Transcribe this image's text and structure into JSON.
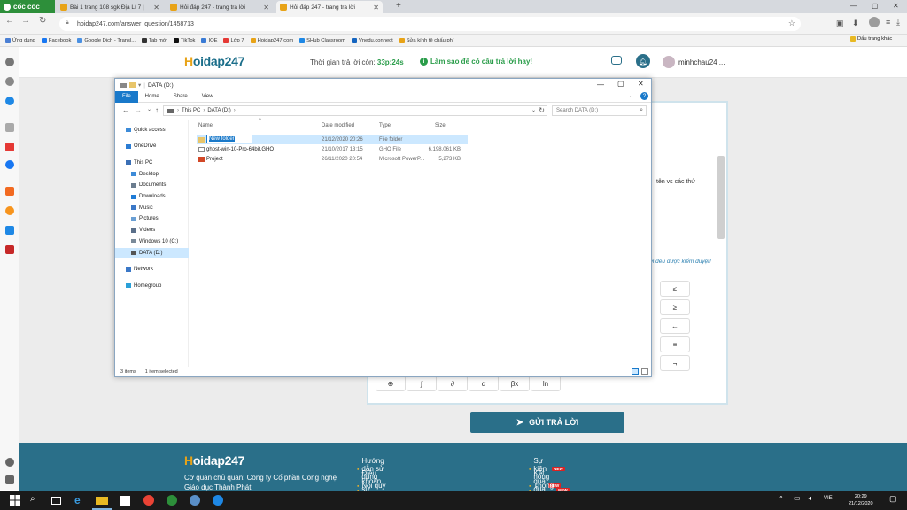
{
  "browser": {
    "brand": "cốc cốc",
    "tabs": [
      {
        "label": "Bài 1 trang 108 sgk Địa Lí 7 |",
        "color": "#e8a317",
        "active": false
      },
      {
        "label": "Hỏi đáp 247 - trang tra lời",
        "color": "#e8a317",
        "active": false
      },
      {
        "label": "Hỏi đáp 247 - trang tra lời",
        "color": "#e8a317",
        "active": true
      }
    ],
    "url": "hoidap247.com/answer_question/1458713",
    "bookmarks": [
      "Ứng dụng",
      "Facebook",
      "Google Dịch - Transl...",
      "Tab mới",
      "TikTok",
      "IOE",
      "Lớp 7",
      "Hoidap247.com",
      "SHub Classroom",
      "Vnedu.connect",
      "Sửa kính tê chấu phí"
    ],
    "bookmark_colors": [
      "#4a7fd4",
      "#1877f2",
      "#4a90e2",
      "#333",
      "#111",
      "#3a7bd5",
      "#e53935",
      "#e8a317",
      "#1e88e5",
      "#1565c0",
      "#e8a317"
    ],
    "other_bookmarks": "Dấu trang khác"
  },
  "site": {
    "logo_h": "H",
    "logo_rest": "oidap247",
    "timer_label": "Thời gian trả lời còn:",
    "timer_value": "33p:24s",
    "tip": "Làm sao để có câu trả lời hay!",
    "username": "minhchau24 ...",
    "text_right": "tên vs các thứ",
    "text_pending": "ời đều được kiểm duyệt!",
    "keyboard": [
      "≤",
      "≥",
      "←",
      "≡",
      "¬"
    ],
    "toolbar": [
      "⊕",
      "∫",
      "∂",
      "α",
      "βx",
      "ln"
    ],
    "submit": "GỬI TRẢ LỜI"
  },
  "footer": {
    "logo_h": "H",
    "logo_rest": "oidap247",
    "company_line1": "Cơ quan chủ quản: Công ty Cổ phần Công nghệ",
    "company_line2": "Giáo dục Thành Phát",
    "links_left": [
      "Hướng dẫn sử dụng",
      "Điều khoản sử dụng",
      "Nội quy hoidap247"
    ],
    "links_right": [
      "Sự kiện nóng",
      "Kết quả đua top",
      "Thông báo"
    ],
    "new_badge": "NEW"
  },
  "explorer": {
    "title": "DATA (D:)",
    "ribbon_tabs": [
      "File",
      "Home",
      "Share",
      "View"
    ],
    "path": [
      "This PC",
      "DATA (D:)"
    ],
    "search_placeholder": "Search DATA (D:)",
    "nav": [
      {
        "label": "Quick access",
        "indent": 0,
        "gap": false,
        "selected": false,
        "color": "#3d8bd8"
      },
      {
        "label": "OneDrive",
        "indent": 0,
        "gap": true,
        "selected": false,
        "color": "#2b7cd3"
      },
      {
        "label": "This PC",
        "indent": 0,
        "gap": true,
        "selected": false,
        "color": "#3b6fb5"
      },
      {
        "label": "Desktop",
        "indent": 1,
        "gap": false,
        "selected": false,
        "color": "#3d8bd8"
      },
      {
        "label": "Documents",
        "indent": 1,
        "gap": false,
        "selected": false,
        "color": "#6b7d8f"
      },
      {
        "label": "Downloads",
        "indent": 1,
        "gap": false,
        "selected": false,
        "color": "#1e7bd6"
      },
      {
        "label": "Music",
        "indent": 1,
        "gap": false,
        "selected": false,
        "color": "#3b78c7"
      },
      {
        "label": "Pictures",
        "indent": 1,
        "gap": false,
        "selected": false,
        "color": "#6a9fd4"
      },
      {
        "label": "Videos",
        "indent": 1,
        "gap": false,
        "selected": false,
        "color": "#5a6f8a"
      },
      {
        "label": "Windows 10 (C:)",
        "indent": 1,
        "gap": false,
        "selected": false,
        "color": "#7a8a99"
      },
      {
        "label": "DATA (D:)",
        "indent": 1,
        "gap": false,
        "selected": true,
        "color": "#555"
      },
      {
        "label": "Network",
        "indent": 0,
        "gap": true,
        "selected": false,
        "color": "#3b78c7"
      },
      {
        "label": "Homegroup",
        "indent": 0,
        "gap": true,
        "selected": false,
        "color": "#2aa0d8"
      }
    ],
    "columns": [
      "Name",
      "Date modified",
      "Type",
      "Size"
    ],
    "files": [
      {
        "name": "New folder",
        "date": "21/12/2020 20:26",
        "type": "File folder",
        "size": "",
        "icon": "folder",
        "selected": true,
        "editing": true
      },
      {
        "name": "ghost-win-10-Pro-64bit.GHO",
        "date": "21/10/2017 13:15",
        "type": "GHO File",
        "size": "6,198,061 KB",
        "icon": "file",
        "selected": false,
        "editing": false
      },
      {
        "name": "Project",
        "date": "26/11/2020 20:54",
        "type": "Microsoft PowerP...",
        "size": "5,273 KB",
        "icon": "ppt",
        "selected": false,
        "editing": false
      }
    ],
    "status_items": "3 items",
    "status_selected": "1 item selected"
  },
  "taskbar": {
    "lang": "VIE",
    "time": "20:29",
    "date": "21/12/2020"
  }
}
